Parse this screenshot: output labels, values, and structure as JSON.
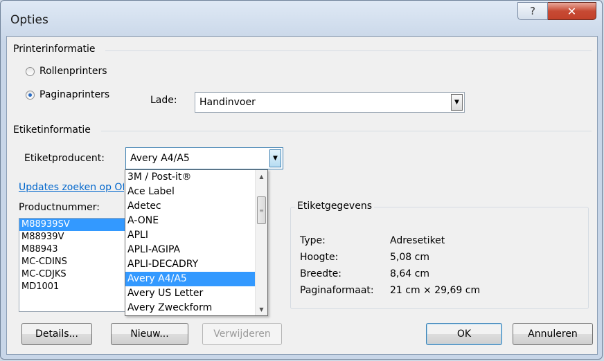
{
  "window": {
    "title": "Opties",
    "help_glyph": "?",
    "close_glyph": "✕"
  },
  "printer_group": {
    "label": "Printerinformatie",
    "radio_roll": "Rollenprinters",
    "radio_page": "Paginaprinters",
    "tray_label": "Lade:",
    "tray_value": "Handinvoer"
  },
  "label_group": {
    "label": "Etiketinformatie",
    "vendor_label": "Etiketproducent:",
    "vendor_value": "Avery A4/A5",
    "updates_link": "Updates zoeken op Office.com",
    "product_label": "Productnummer:"
  },
  "vendor_dropdown": {
    "items": [
      "3M / Post-it®",
      "Ace Label",
      "Adetec",
      "A-ONE",
      "APLI",
      "APLI-AGIPA",
      "APLI-DECADRY",
      "Avery A4/A5",
      "Avery US Letter",
      "Avery Zweckform"
    ],
    "selected": "Avery A4/A5"
  },
  "product_list": {
    "items": [
      "M88939SV",
      "M88939V",
      "M88943",
      "MC-CDINS",
      "MC-CDJKS",
      "MD1001"
    ],
    "selected": "M88939SV"
  },
  "label_details": {
    "title": "Etiketgegevens",
    "rows": [
      {
        "key": "Type:",
        "value": "Adresetiket"
      },
      {
        "key": "Hoogte:",
        "value": "5,08 cm"
      },
      {
        "key": "Breedte:",
        "value": "8,64 cm"
      },
      {
        "key": "Paginaformaat:",
        "value": "21 cm × 29,69 cm"
      }
    ]
  },
  "buttons": {
    "details": "Details...",
    "new": "Nieuw...",
    "delete": "Verwijderen",
    "ok": "OK",
    "cancel": "Annuleren"
  }
}
